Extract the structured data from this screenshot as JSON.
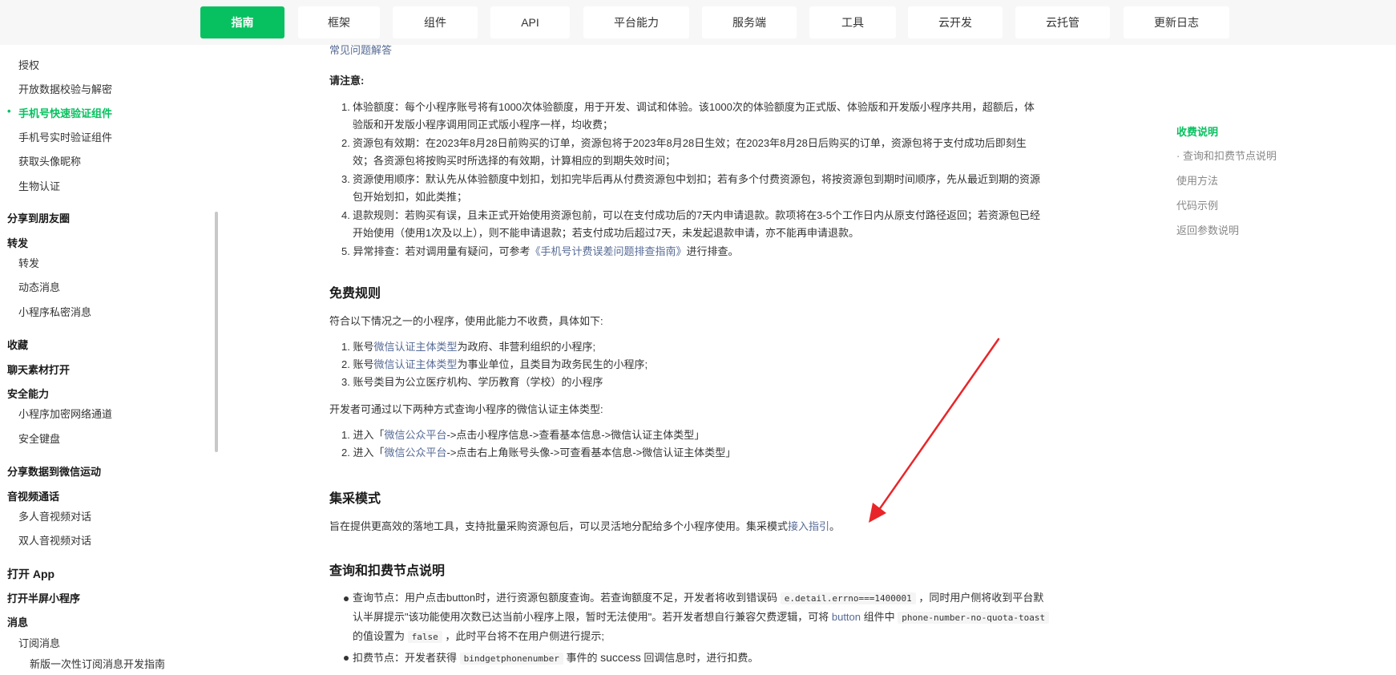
{
  "topnav": {
    "tabs": [
      "指南",
      "框架",
      "组件",
      "API",
      "平台能力",
      "服务端",
      "工具",
      "云开发",
      "云托管",
      "更新日志"
    ]
  },
  "sidebar": {
    "items": [
      {
        "label": "授权",
        "type": "sub"
      },
      {
        "label": "开放数据校验与解密",
        "type": "sub"
      },
      {
        "label": "手机号快速验证组件",
        "type": "active"
      },
      {
        "label": "手机号实时验证组件",
        "type": "sub"
      },
      {
        "label": "获取头像昵称",
        "type": "sub"
      },
      {
        "label": "生物认证",
        "type": "sub"
      },
      {
        "label": "分享到朋友圈",
        "type": "group"
      },
      {
        "label": "转发",
        "type": "group"
      },
      {
        "label": "转发",
        "type": "sub"
      },
      {
        "label": "动态消息",
        "type": "sub"
      },
      {
        "label": "小程序私密消息",
        "type": "sub"
      },
      {
        "label": "收藏",
        "type": "group"
      },
      {
        "label": "聊天素材打开",
        "type": "group"
      },
      {
        "label": "安全能力",
        "type": "group"
      },
      {
        "label": "小程序加密网络通道",
        "type": "sub"
      },
      {
        "label": "安全键盘",
        "type": "sub"
      },
      {
        "label": "分享数据到微信运动",
        "type": "group"
      },
      {
        "label": "音视频通话",
        "type": "group"
      },
      {
        "label": "多人音视频对话",
        "type": "sub"
      },
      {
        "label": "双人音视频对话",
        "type": "sub"
      },
      {
        "label": "打开 App",
        "type": "group"
      },
      {
        "label": "打开半屏小程序",
        "type": "group"
      },
      {
        "label": "消息",
        "type": "group"
      },
      {
        "label": "订阅消息",
        "type": "sub"
      },
      {
        "label": "新版一次性订阅消息开发指南",
        "type": "sub2"
      }
    ]
  },
  "content": {
    "cut_link": "常见问题解答",
    "notice_title": "请注意:",
    "notice_items": [
      {
        "num": "1.",
        "line1": "体验额度：每个小程序账号将有1000次体验额度，用于开发、调试和体验。该1000次的体验额度为正式版、体验版和开发版小程序共用，超额后，体",
        "line2": "验版和开发版小程序调用同正式版小程序一样，均收费；"
      },
      {
        "num": "2.",
        "line1": "资源包有效期：在2023年8月28日前购买的订单，资源包将于2023年8月28日生效；在2023年8月28日后购买的订单，资源包将于支付成功后即刻生",
        "line2": "效；各资源包将按购买时所选择的有效期，计算相应的到期失效时间；"
      },
      {
        "num": "3.",
        "line1": "资源使用顺序：默认先从体验额度中划扣，划扣完毕后再从付费资源包中划扣；若有多个付费资源包，将按资源包到期时间顺序，先从最近到期的资源",
        "line2": "包开始划扣，如此类推；"
      },
      {
        "num": "4.",
        "line1": "退款规则：若购买有误，且未正式开始使用资源包前，可以在支付成功后的7天内申请退款。款项将在3-5个工作日内从原支付路径返回；若资源包已经",
        "line2": "开始使用（使用1次及以上），则不能申请退款；若支付成功后超过7天，未发起退款申请，亦不能再申请退款。"
      }
    ],
    "notice5_prefix": "异常排查：若对调用量有疑问，可参考",
    "notice5_link": "《手机号计费误差问题排查指南》",
    "notice5_suffix": "进行排查。",
    "free_title": "免费规则",
    "free_intro": "符合以下情况之一的小程序，使用此能力不收费，具体如下:",
    "free_items": [
      {
        "num": "1.",
        "prefix": "账号",
        "link": "微信认证主体类型",
        "suffix": "为政府、非营利组织的小程序;"
      },
      {
        "num": "2.",
        "prefix": "账号",
        "link": "微信认证主体类型",
        "suffix": "为事业单位，且类目为政务民生的小程序;"
      },
      {
        "num": "3.",
        "prefix": "账号类目为公立医疗机构、学历教育（学校）的小程序",
        "link": "",
        "suffix": ""
      }
    ],
    "query_intro": "开发者可通过以下两种方式查询小程序的微信认证主体类型:",
    "query_items": [
      {
        "num": "1.",
        "prefix": "进入「",
        "link": "微信公众平台",
        "suffix": "->点击小程序信息->查看基本信息->微信认证主体类型」"
      },
      {
        "num": "2.",
        "prefix": "进入「",
        "link": "微信公众平台",
        "suffix": "->点击右上角账号头像->可查看基本信息->微信认证主体类型」"
      }
    ],
    "collect_title": "集采模式",
    "collect_text": "旨在提供更高效的落地工具，支持批量采购资源包后，可以灵活地分配给多个小程序使用。集采模式",
    "collect_link": "接入指引",
    "collect_end": "。",
    "node_title": "查询和扣费节点说明",
    "node1_a": "查询节点：用户点击button时，进行资源包额度查询。若查询额度不足，开发者将收到错误码",
    "node1_code1": "e.detail.errno===1400001",
    "node1_b": "，同时用户侧将收到平台默",
    "node1_c": "认半屏提示\"该功能使用次数已达当前小程序上限，暂时无法使用\"。若开发者想自行兼容欠费逻辑，可将",
    "node1_btn": "button",
    "node1_d": "组件中",
    "node1_code2": "phone-number-no-quota-toast",
    "node1_e": "的值设置为",
    "node1_code3": "false",
    "node1_f": "，此时平台将不在用户侧进行提示;",
    "node2_a": "扣费节点：开发者获得",
    "node2_code": "bindgetphonenumber",
    "node2_b": "事件的",
    "node2_success": "success",
    "node2_c": "回调信息时，进行扣费。"
  },
  "toc": {
    "items": [
      "收费说明",
      "· 查询和扣费节点说明",
      "使用方法",
      "代码示例",
      "返回参数说明"
    ]
  },
  "colors": {
    "brand_green": "#07c160",
    "link_blue": "#576b95",
    "annotation_red": "#e8262a"
  }
}
